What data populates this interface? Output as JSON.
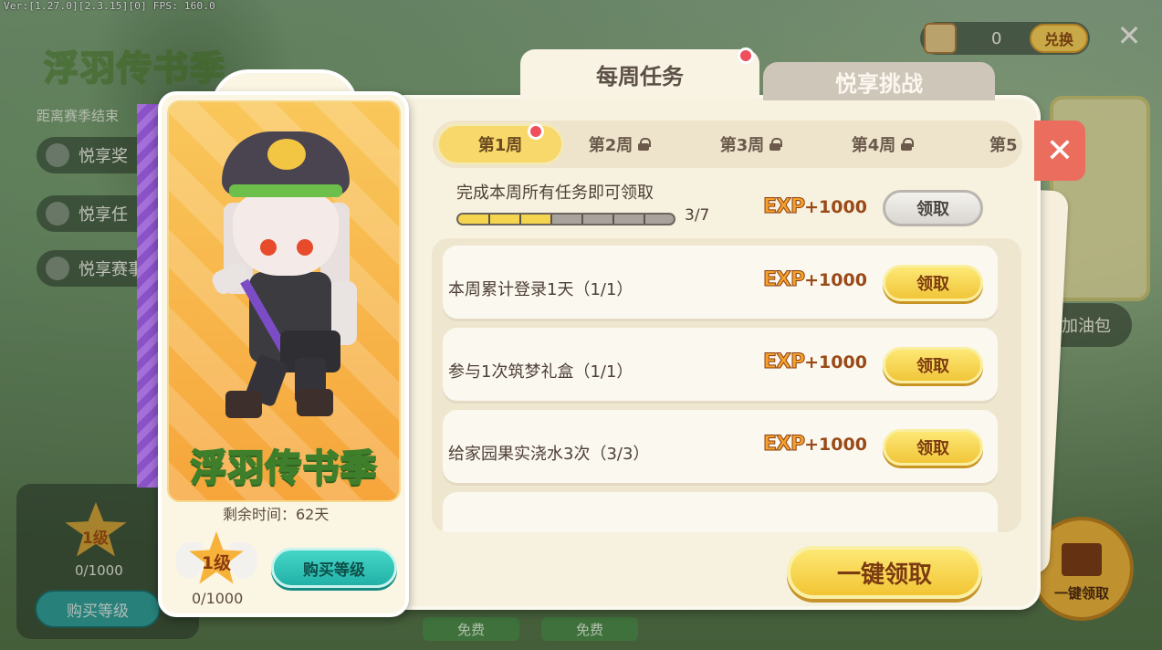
{
  "debug": {
    "text": "Ver:[1.27.0][2.3.15][0] FPS: 160.0"
  },
  "background": {
    "countdown_label": "距离赛季结束",
    "menu": [
      "悦享奖",
      "悦享任",
      "悦享赛事"
    ],
    "currency_amount": "0",
    "exchange_label": "兑换",
    "jiayou_label": "加油包",
    "level_label": "1级",
    "level_exp": "0/1000",
    "buy_level": "购买等级",
    "free_1": "免费",
    "free_2": "免费",
    "gift_label": "一键领取"
  },
  "tabs": {
    "weekly": "每周任务",
    "challenge": "悦享挑战"
  },
  "weeks": [
    {
      "label": "第1周",
      "locked": false,
      "active": true
    },
    {
      "label": "第2周",
      "locked": true
    },
    {
      "label": "第3周",
      "locked": true
    },
    {
      "label": "第4周",
      "locked": true
    },
    {
      "label": "第5",
      "locked": false
    }
  ],
  "weekly_goal": {
    "label": "完成本周所有任务即可领取",
    "progress_text": "3/7",
    "progress_fraction": 0.43,
    "exp_word": "EXP",
    "exp_amount": "+1000",
    "claim_label": "领取"
  },
  "tasks": [
    {
      "label": "本周累计登录1天（1/1）",
      "exp_word": "EXP",
      "exp_amount": "+1000",
      "claim_label": "领取"
    },
    {
      "label": "参与1次筑梦礼盒（1/1）",
      "exp_word": "EXP",
      "exp_amount": "+1000",
      "claim_label": "领取"
    },
    {
      "label": "给家园果实浇水3次（3/3）",
      "exp_word": "EXP",
      "exp_amount": "+1000",
      "claim_label": "领取"
    }
  ],
  "one_key_claim": "一键领取",
  "season_card": {
    "title": "浮羽传书季",
    "remaining": "剩余时间：62天",
    "level_label": "1级",
    "level_exp": "0/1000",
    "buy_level": "购买等级"
  },
  "colors": {
    "accent_gold": "#f5d44e",
    "accent_teal": "#21b1a6",
    "red_dot": "#ef4e5c",
    "close_red": "#ea6d5d"
  }
}
